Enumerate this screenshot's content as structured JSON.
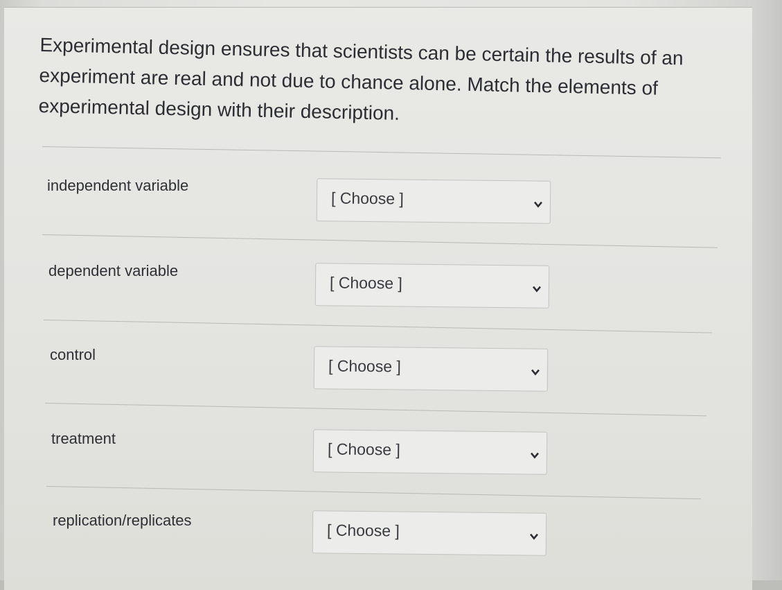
{
  "question": {
    "text": "Experimental design ensures that scientists can be certain the results of an experiment are real and not due to chance alone. Match the elements of experimental design with their description."
  },
  "matches": [
    {
      "term": "independent variable",
      "selected": "[ Choose ]"
    },
    {
      "term": "dependent variable",
      "selected": "[ Choose ]"
    },
    {
      "term": "control",
      "selected": "[ Choose ]"
    },
    {
      "term": "treatment",
      "selected": "[ Choose ]"
    },
    {
      "term": "replication/replicates",
      "selected": "[ Choose ]"
    }
  ],
  "icons": {
    "dropdown": "chevron-down-icon"
  }
}
